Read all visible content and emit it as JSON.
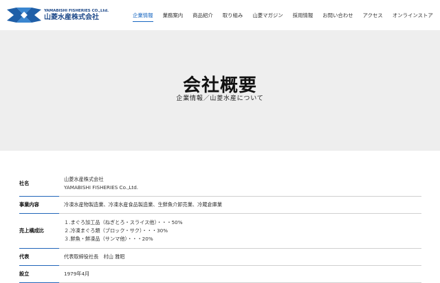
{
  "header": {
    "logo": {
      "en": "YAMABISHI FISHERIES CO.,Ltd.",
      "jp": "山菱水産株式会社"
    },
    "nav": [
      {
        "label": "企業情報",
        "active": true
      },
      {
        "label": "業務案内",
        "active": false
      },
      {
        "label": "商品紹介",
        "active": false
      },
      {
        "label": "取り組み",
        "active": false
      },
      {
        "label": "山菱マガジン",
        "active": false
      },
      {
        "label": "採用情報",
        "active": false
      },
      {
        "label": "お問い合わせ",
        "active": false
      },
      {
        "label": "アクセス",
        "active": false
      },
      {
        "label": "オンラインストア",
        "active": false
      }
    ]
  },
  "hero": {
    "title": "会社概要",
    "subtitle": "企業情報／山菱水産について"
  },
  "company_table": [
    {
      "label": "社名",
      "lines": [
        "山菱水産株式会社",
        "YAMABISHI FISHERIES Co.,Ltd."
      ]
    },
    {
      "label": "事業内容",
      "lines": [
        "冷凍水産物製造業、冷凍水産食品製造業、生鮮魚介卸売業、冷蔵倉庫業"
      ]
    },
    {
      "label": "売上構成比",
      "lines": [
        "１.まぐろ加工品（ねぎとろ・スライス他）・・・50%",
        "２.冷凍まぐろ類（ブロック・サク）・・・30%",
        "３.鮮魚・鮮凍品（サンマ他）・・・20%"
      ]
    },
    {
      "label": "代表",
      "lines": [
        "代表取締役社長　村山 雅昭"
      ]
    },
    {
      "label": "設立",
      "lines": [
        "1979年4月"
      ]
    }
  ],
  "colors": {
    "accent": "#1565c0",
    "hero_bg": "#eeeeee",
    "brand": "#1f4a8a"
  }
}
